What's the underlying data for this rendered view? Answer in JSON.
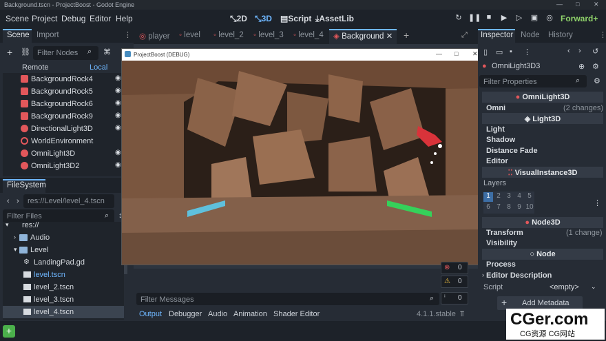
{
  "window": {
    "title": "Background.tscn - ProjectBoost - Godot Engine",
    "controls": [
      "—",
      "□",
      "✕"
    ]
  },
  "menu": [
    "Scene",
    "Project",
    "Debug",
    "Editor",
    "Help"
  ],
  "workspaces": [
    {
      "label": "2D"
    },
    {
      "label": "3D"
    },
    {
      "label": "Script"
    },
    {
      "label": "AssetLib"
    }
  ],
  "renderer": "Forward+",
  "scene_dock": {
    "tabs": [
      "Scene",
      "Import"
    ],
    "filter_placeholder": "Filter Nodes",
    "remote": "Remote",
    "local": "Local",
    "nodes": [
      {
        "name": "BackgroundRock4",
        "icon": "mesh-icon"
      },
      {
        "name": "BackgroundRock5",
        "icon": "mesh-icon"
      },
      {
        "name": "BackgroundRock6",
        "icon": "mesh-icon"
      },
      {
        "name": "BackgroundRock9",
        "icon": "mesh-icon"
      },
      {
        "name": "DirectionalLight3D",
        "icon": "light-icon"
      },
      {
        "name": "WorldEnvironment",
        "icon": "globe-icon"
      },
      {
        "name": "OmniLight3D",
        "icon": "light-icon"
      },
      {
        "name": "OmniLight3D2",
        "icon": "light-icon"
      }
    ]
  },
  "filesystem": {
    "tab": "FileSystem",
    "path": "res://Level/level_4.tscn",
    "filter_placeholder": "Filter Files",
    "items": [
      {
        "name": "res://",
        "indent": 0,
        "type": "folder"
      },
      {
        "name": "Audio",
        "indent": 1,
        "type": "folder"
      },
      {
        "name": "Level",
        "indent": 1,
        "type": "folder"
      },
      {
        "name": "LandingPad.gd",
        "indent": 2,
        "type": "script"
      },
      {
        "name": "level.tscn",
        "indent": 2,
        "type": "scene",
        "highlight": true
      },
      {
        "name": "level_2.tscn",
        "indent": 2,
        "type": "scene"
      },
      {
        "name": "level_3.tscn",
        "indent": 2,
        "type": "scene"
      },
      {
        "name": "level_4.tscn",
        "indent": 2,
        "type": "scene",
        "selected": true
      }
    ]
  },
  "editor_tabs": [
    "player",
    "level",
    "level_2",
    "level_3",
    "level_4",
    "Background"
  ],
  "game_window": {
    "title": "ProjectBoost (DEBUG)"
  },
  "output": {
    "filter_placeholder": "Filter Messages",
    "counters": [
      "0",
      "0",
      "0"
    ],
    "tabs": [
      "Output",
      "Debugger",
      "Audio",
      "Animation",
      "Shader Editor"
    ],
    "version": "4.1.1.stable"
  },
  "inspector": {
    "tabs": [
      "Inspector",
      "Node",
      "History"
    ],
    "node": "OmniLight3D3",
    "filter_placeholder": "Filter Properties",
    "sections": {
      "omni_light": "OmniLight3D",
      "light": "Light3D",
      "visual": "VisualInstance3D",
      "node3d": "Node3D",
      "node": "Node"
    },
    "omni": {
      "label": "Omni",
      "changes": "(2 changes)"
    },
    "light_props": [
      "Light",
      "Shadow",
      "Distance Fade",
      "Editor"
    ],
    "layers": {
      "label": "Layers",
      "nums": [
        "1",
        "2",
        "3",
        "4",
        "5",
        "6",
        "7",
        "8",
        "9",
        "10"
      ]
    },
    "transform": {
      "label": "Transform",
      "changes": "(1 change)"
    },
    "visibility": "Visibility",
    "process": "Process",
    "editor_description": "Editor Description",
    "script": {
      "label": "Script",
      "value": "<empty>"
    },
    "add_metadata": "Add Metadata"
  },
  "watermark": {
    "line1": "CGer.com",
    "line2": "CG资源 CG网站"
  }
}
